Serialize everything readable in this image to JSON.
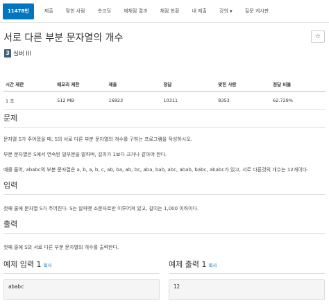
{
  "nav": {
    "problem_id": "11478번",
    "items": [
      "제출",
      "맞힌 사람",
      "숏코딩",
      "재채점 결과",
      "채점 현황",
      "내 제출"
    ],
    "lecture": "강의",
    "board": "질문 게시판"
  },
  "problem": {
    "title": "서로 다른 부분 문자열의 개수",
    "star": "☆",
    "tier_level": "3",
    "tier_name": "실버 III"
  },
  "stats": {
    "headers": [
      "시간 제한",
      "메모리 제한",
      "제출",
      "정답",
      "맞힌 사람",
      "정답 비율"
    ],
    "values": [
      "1 초",
      "512 MB",
      "16823",
      "10311",
      "8353",
      "62.729%"
    ]
  },
  "sections": {
    "problem": {
      "heading": "문제",
      "lines": [
        "문자열 S가 주어졌을 때, S의 서로 다른 부분 문자열의 개수를 구하는 프로그램을 작성하시오.",
        "부분 문자열은 S에서 연속된 일부분을 말하며, 길이가 1보다 크거나 같아야 한다.",
        "예를 들어, ababc의 부분 문자열은 a, b, a, b, c, ab, ba, ab, bc, aba, bab, abc, abab, babc, ababc가 있고, 서로 다른것의 개수는 12개이다."
      ]
    },
    "input": {
      "heading": "입력",
      "line": "첫째 줄에 문자열 S가 주어진다. S는 알파벳 소문자로만 이루어져 있고, 길이는 1,000 이하이다."
    },
    "output": {
      "heading": "출력",
      "line": "첫째 줄에 S의 서로 다른 부분 문자열의 개수를 출력한다."
    }
  },
  "samples": {
    "input_title": "예제 입력 1",
    "output_title": "예제 출력 1",
    "copy_label": "복사",
    "input_value": "ababc",
    "output_value": "12"
  }
}
